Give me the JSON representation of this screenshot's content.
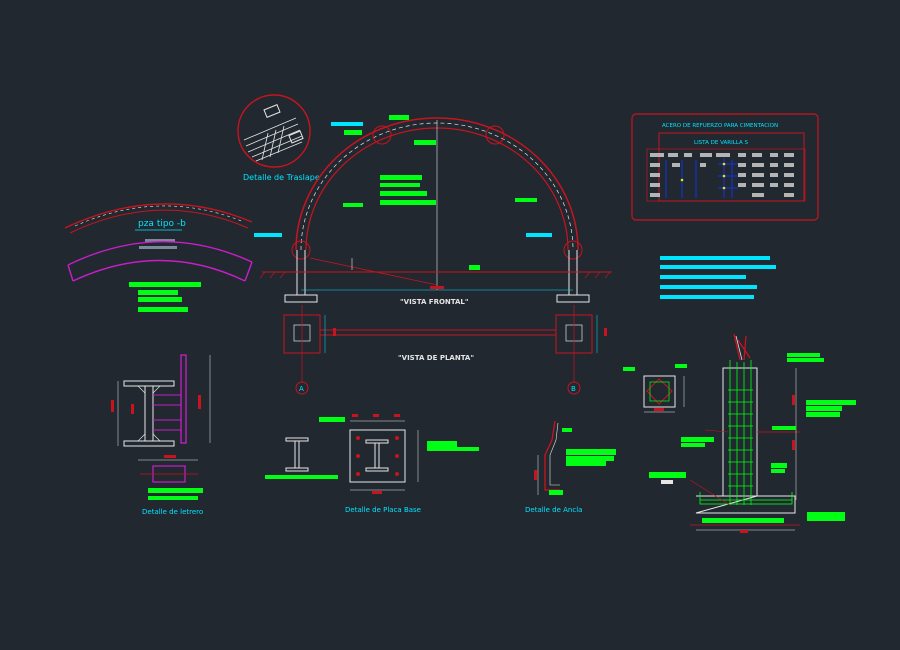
{
  "colors": {
    "background": "#212830",
    "red": "#c8141e",
    "cyan": "#00e5ff",
    "green": "#00ff14",
    "magenta": "#c81ec8",
    "white": "#e6e6e6",
    "yellow": "#e6e614",
    "blue": "#1432c8"
  },
  "labels": {
    "detalle_traslape": "Detalle de Traslape",
    "pza_tipo": "pza tipo -b",
    "vista_frontal": "\"VISTA FRONTAL\"",
    "vista_planta": "\"VISTA DE PLANTA\"",
    "axis_a": "A",
    "axis_b": "B",
    "detalle_letrero": "Detalle de letrero",
    "detalle_placa": "Detalle de Placa  Base",
    "detalle_ancla": "Detalle de Ancla",
    "acero_title": "ACERO DE REFUERZO PARA CIMENTACION",
    "lista_varilla": "LISTA DE VARILLA S"
  }
}
